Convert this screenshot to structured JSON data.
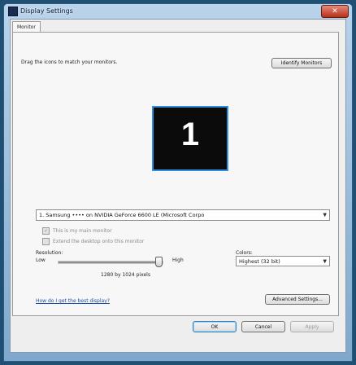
{
  "window": {
    "title": "Display Settings",
    "close_label": "✕"
  },
  "tabs": [
    {
      "label": "Monitor"
    }
  ],
  "monitor": {
    "instruction": "Drag the icons to match your monitors.",
    "identify_label": "Identify Monitors",
    "number": "1",
    "selected_display": "1. Samsung •••• on NVIDIA GeForce 6600 LE (Microsoft Corpo",
    "main_monitor_label": "This is my main monitor",
    "extend_label": "Extend the desktop onto this monitor"
  },
  "resolution": {
    "label": "Resolution:",
    "low_label": "Low",
    "high_label": "High",
    "value_text": "1280 by 1024 pixels",
    "slider_level": 0.97
  },
  "colors": {
    "label": "Colors:",
    "selected": "Highest (32 bit)"
  },
  "help_link": "How do I get the best display?",
  "advanced_label": "Advanced Settings...",
  "buttons": {
    "ok": "OK",
    "cancel": "Cancel",
    "apply": "Apply"
  }
}
